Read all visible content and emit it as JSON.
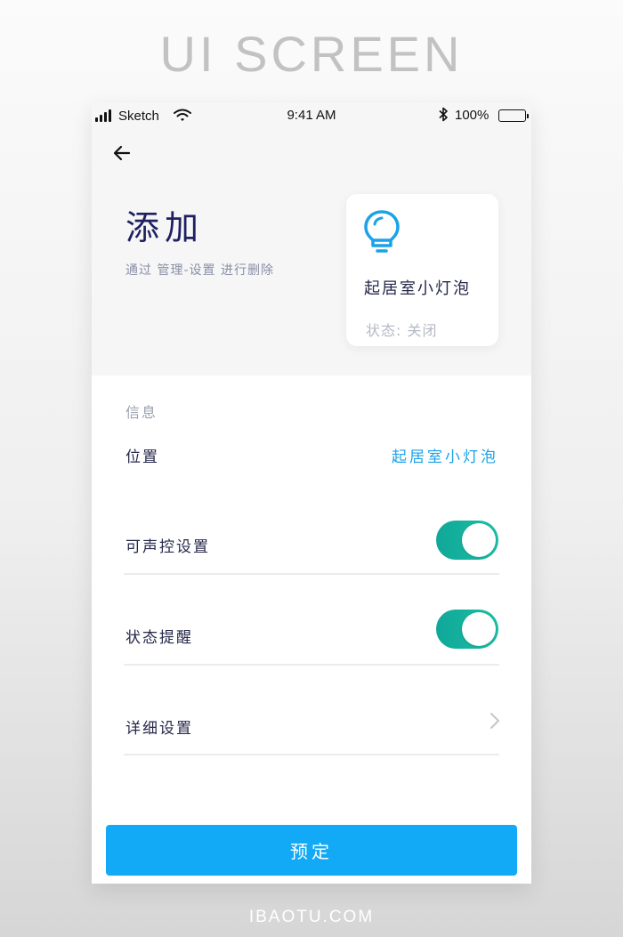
{
  "page_heading": "UI SCREEN",
  "footer_site": "IBAOTU.COM",
  "status_bar": {
    "carrier": "Sketch",
    "time": "9:41 AM",
    "battery": "100%",
    "icons": [
      "signal-icon",
      "wifi-icon",
      "bluetooth-icon",
      "battery-icon"
    ]
  },
  "header": {
    "back_icon": "back-arrow-icon",
    "title": "添加",
    "subtitle": "通过 管理-设置 进行删除"
  },
  "device_card": {
    "icon": "lightbulb-icon",
    "name": "起居室小灯泡",
    "status": "状态:  关闭"
  },
  "info": {
    "section_label": "信息",
    "location_label": "位置",
    "location_value": "起居室小灯泡",
    "voice_control_label": "可声控设置",
    "voice_control_on": true,
    "status_reminder_label": "状态提醒",
    "status_reminder_on": true,
    "details_label": "详细设置",
    "details_icon": "chevron-right-icon"
  },
  "reserve_button_label": "预定",
  "colors": {
    "accent_blue": "#12a9f6",
    "toggle_green": "#14b39f",
    "title_navy": "#1e2060",
    "value_blue": "#1ca2e8"
  }
}
